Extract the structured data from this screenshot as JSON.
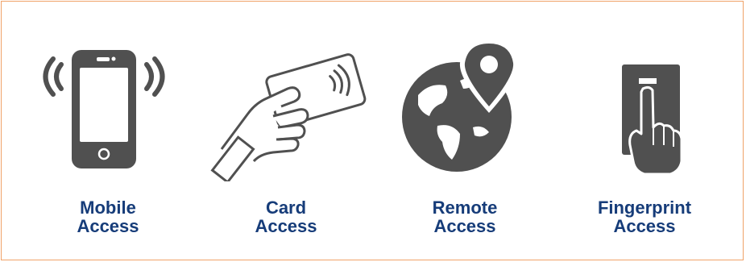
{
  "colors": {
    "border": "#f0a268",
    "label": "#163c79",
    "icon": "#505050",
    "icon_light": "#ffffff"
  },
  "items": [
    {
      "icon": "mobile-phone-icon",
      "line1": "Mobile",
      "line2": "Access"
    },
    {
      "icon": "contactless-card-icon",
      "line1": "Card",
      "line2": "Access"
    },
    {
      "icon": "globe-location-pin-icon",
      "line1": "Remote",
      "line2": "Access"
    },
    {
      "icon": "fingerprint-reader-icon",
      "line1": "Fingerprint",
      "line2": "Access"
    }
  ]
}
